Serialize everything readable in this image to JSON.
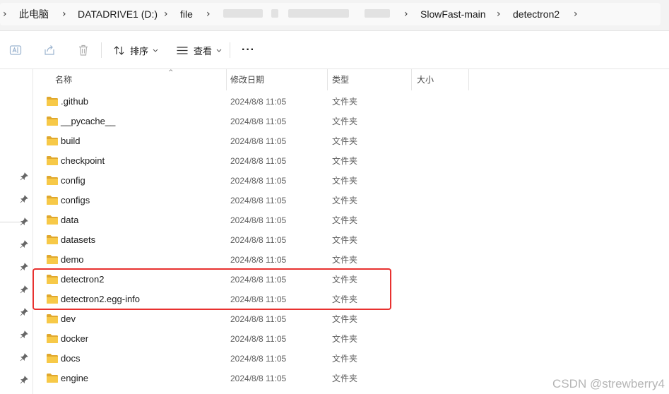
{
  "address_bar": {
    "crumbs": [
      "此电脑",
      "DATADRIVE1 (D:)",
      "file",
      "SlowFast-main",
      "detectron2"
    ]
  },
  "command_bar": {
    "sort_label": "排序",
    "view_label": "查看",
    "more_label": "···"
  },
  "columns": {
    "name": "名称",
    "modified": "修改日期",
    "type": "类型",
    "size": "大小"
  },
  "files": [
    {
      "name": ".github",
      "modified": "2024/8/8 11:05",
      "type": "文件夹"
    },
    {
      "name": "__pycache__",
      "modified": "2024/8/8 11:05",
      "type": "文件夹"
    },
    {
      "name": "build",
      "modified": "2024/8/8 11:05",
      "type": "文件夹"
    },
    {
      "name": "checkpoint",
      "modified": "2024/8/8 11:05",
      "type": "文件夹"
    },
    {
      "name": "config",
      "modified": "2024/8/8 11:05",
      "type": "文件夹"
    },
    {
      "name": "configs",
      "modified": "2024/8/8 11:05",
      "type": "文件夹"
    },
    {
      "name": "data",
      "modified": "2024/8/8 11:05",
      "type": "文件夹"
    },
    {
      "name": "datasets",
      "modified": "2024/8/8 11:05",
      "type": "文件夹"
    },
    {
      "name": "demo",
      "modified": "2024/8/8 11:05",
      "type": "文件夹"
    },
    {
      "name": "detectron2",
      "modified": "2024/8/8 11:05",
      "type": "文件夹"
    },
    {
      "name": "detectron2.egg-info",
      "modified": "2024/8/8 11:05",
      "type": "文件夹"
    },
    {
      "name": "dev",
      "modified": "2024/8/8 11:05",
      "type": "文件夹"
    },
    {
      "name": "docker",
      "modified": "2024/8/8 11:05",
      "type": "文件夹"
    },
    {
      "name": "docs",
      "modified": "2024/8/8 11:05",
      "type": "文件夹"
    },
    {
      "name": "engine",
      "modified": "2024/8/8 11:05",
      "type": "文件夹"
    }
  ],
  "watermark": "CSDN @strewberry4",
  "colors": {
    "folder": "#f7c948",
    "folder_dark": "#e0a82e",
    "highlight": "#e8312f"
  }
}
